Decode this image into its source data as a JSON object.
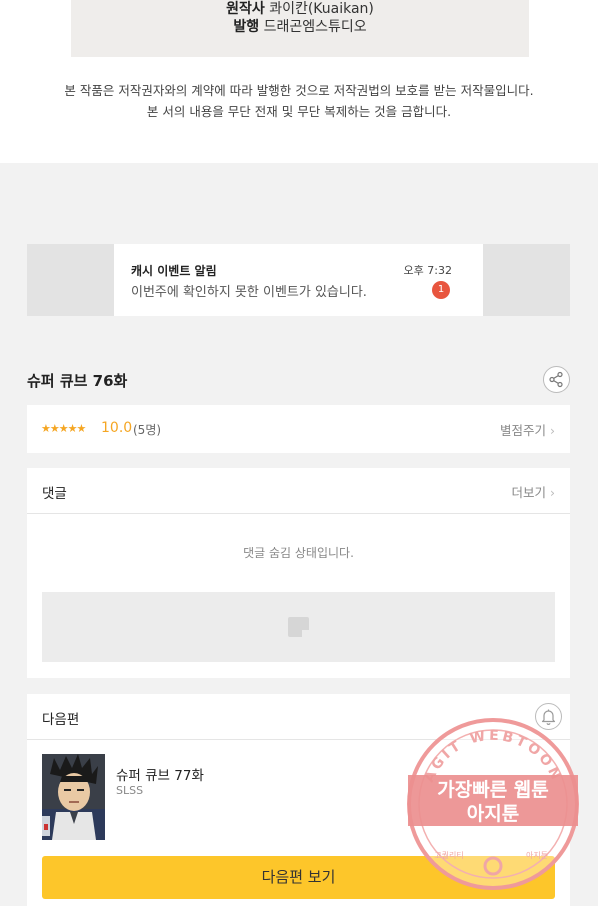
{
  "credits": {
    "original_label": "원작사",
    "original_value": "콰이칸(Kuaikan)",
    "publisher_label": "발행",
    "publisher_value": "드래곤엠스튜디오"
  },
  "copyright_notice": [
    "본 작품은 저작권자와의 계약에 따라 발행한 것으로 저작권법의 보호를 받는 저작물입니다.",
    "본 서의 내용을 무단 전재 및 무단 복제하는 것을 금합니다."
  ],
  "push_notification": {
    "title": "캐시 이벤트 알림",
    "body": "이번주에 확인하지 못한 이벤트가 있습니다.",
    "time": "오후 7:32",
    "badge": "1"
  },
  "episode": {
    "title": "슈퍼 큐브 76화",
    "share_icon": "share-icon"
  },
  "rating": {
    "stars": "★★★★★",
    "score": "10.0",
    "count": "(5명)",
    "rate_link": "별점주기",
    "star_color": "#f5a623"
  },
  "comments": {
    "title": "댓글",
    "more": "더보기",
    "hidden_message": "댓글 숨김 상태입니다."
  },
  "next_episode": {
    "section_title": "다음편",
    "bell_icon": "bell-icon",
    "name": "슈퍼 큐브 77화",
    "author": "SLSS",
    "button": "다음편 보기",
    "button_color": "#fdc62a"
  },
  "watermark": {
    "top_text": "AGIT WEBTOON",
    "line1": "가장빠른 웹툰",
    "line2": "아지툰",
    "bottom_left": "고퀄리티",
    "bottom_right": "아지툰"
  }
}
